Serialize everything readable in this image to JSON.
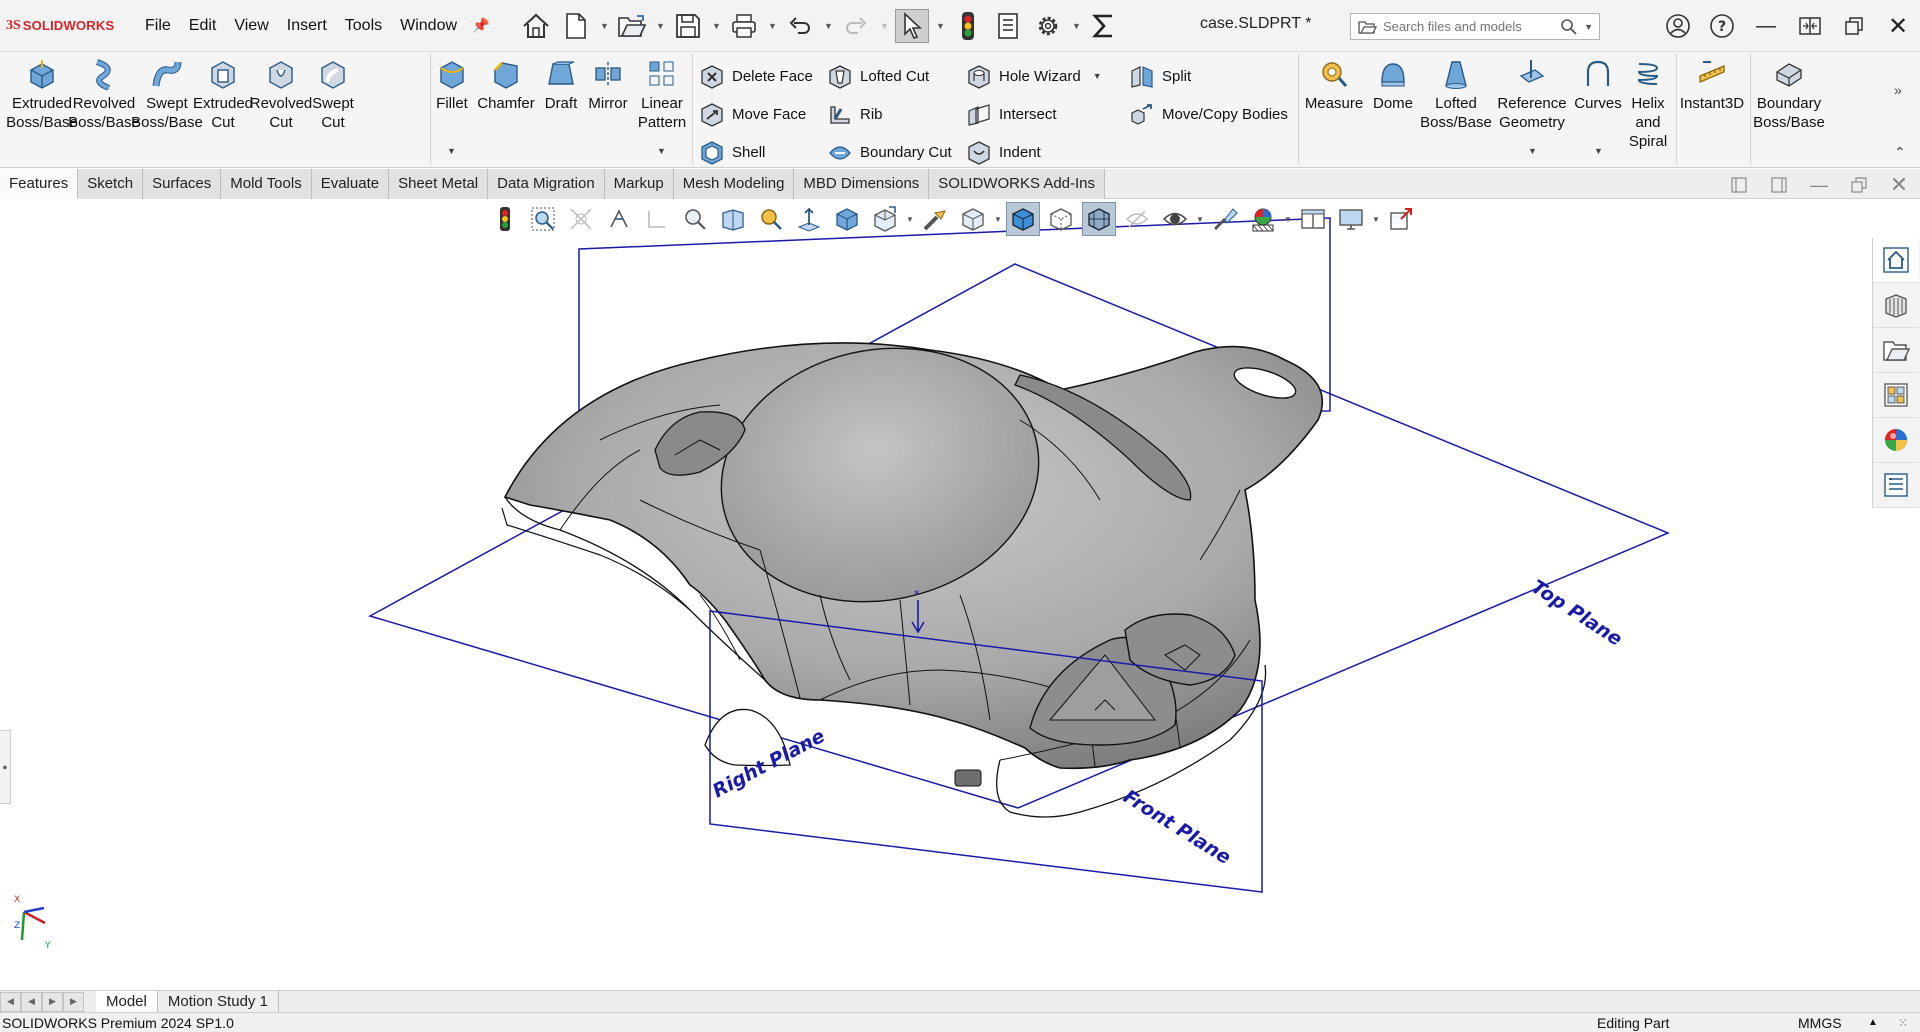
{
  "app": {
    "logo_prefix": "3S",
    "logo_text": "SOLIDWORKS",
    "document_title": "case.SLDPRT *"
  },
  "menu": [
    "File",
    "Edit",
    "View",
    "Insert",
    "Tools",
    "Window"
  ],
  "search": {
    "placeholder": "Search files and models"
  },
  "ribbon": {
    "large": [
      {
        "l1": "Extruded",
        "l2": "Boss/Base"
      },
      {
        "l1": "Revolved",
        "l2": "Boss/Base"
      },
      {
        "l1": "Swept",
        "l2": "Boss/Base"
      },
      {
        "l1": "Extruded",
        "l2": "Cut"
      },
      {
        "l1": "Revolved",
        "l2": "Cut"
      },
      {
        "l1": "Swept",
        "l2": "Cut"
      },
      {
        "l1": "Fillet",
        "l2": ""
      },
      {
        "l1": "Chamfer",
        "l2": ""
      },
      {
        "l1": "Draft",
        "l2": ""
      },
      {
        "l1": "Mirror",
        "l2": ""
      },
      {
        "l1": "Linear",
        "l2": "Pattern"
      }
    ],
    "small": [
      "Delete Face",
      "Move Face",
      "Shell",
      "Lofted Cut",
      "Rib",
      "Boundary Cut",
      "Hole Wizard",
      "Intersect",
      "Indent",
      "Split",
      "Move/Copy Bodies"
    ],
    "right": [
      {
        "l1": "Measure",
        "l2": "",
        "l3": ""
      },
      {
        "l1": "Dome",
        "l2": "",
        "l3": ""
      },
      {
        "l1": "Lofted",
        "l2": "Boss/Base",
        "l3": ""
      },
      {
        "l1": "Reference",
        "l2": "Geometry",
        "l3": ""
      },
      {
        "l1": "Curves",
        "l2": "",
        "l3": ""
      },
      {
        "l1": "Helix",
        "l2": "and",
        "l3": "Spiral"
      },
      {
        "l1": "Instant3D",
        "l2": "",
        "l3": ""
      },
      {
        "l1": "Boundary",
        "l2": "Boss/Base",
        "l3": ""
      }
    ]
  },
  "tabs": [
    "Features",
    "Sketch",
    "Surfaces",
    "Mold Tools",
    "Evaluate",
    "Sheet Metal",
    "Data Migration",
    "Markup",
    "Mesh Modeling",
    "MBD Dimensions",
    "SOLIDWORKS Add-Ins"
  ],
  "planes": {
    "top": "Top Plane",
    "right": "Right Plane",
    "front": "Front Plane"
  },
  "triad": {
    "x": "X",
    "y": "Y",
    "z": "Z"
  },
  "bottom_tabs": [
    "Model",
    "Motion Study 1"
  ],
  "status": {
    "product": "SOLIDWORKS Premium 2024 SP1.0",
    "mode": "Editing Part",
    "units": "MMGS"
  },
  "colors": {
    "brand_red": "#d6242c",
    "plane_blue": "#1a1aa8",
    "model_gray": "#a9a9a9"
  }
}
